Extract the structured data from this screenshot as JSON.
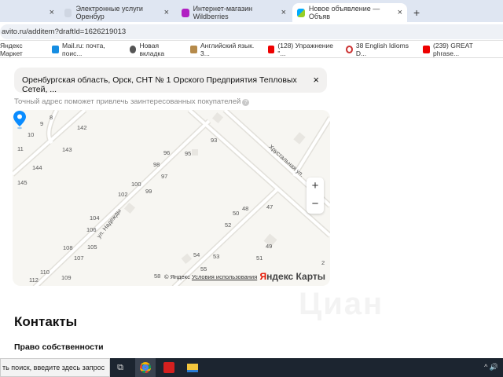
{
  "tabs": [
    {
      "label": "",
      "close": "×"
    },
    {
      "label": "Электронные услуги Оренбур",
      "close": "×"
    },
    {
      "label": "Интернет-магазин Wildberries",
      "close": "×"
    },
    {
      "label": "Новое объявление — Объяв",
      "close": "×",
      "active": true
    }
  ],
  "new_tab": "+",
  "url": "avito.ru/additem?draftId=1626219013",
  "bookmarks": [
    "Яндекс Маркет",
    "Mail.ru: почта, поис...",
    "Новая вкладка",
    "Английский язык. 3...",
    "(128) Упражнение \"...",
    "38 English Idioms D...",
    "(239) GREAT phrase..."
  ],
  "address": {
    "value": "Оренбургская область, Орск, СНТ № 1 Орского Предприятия Тепловых Сетей, ...",
    "clear": "×"
  },
  "hint": {
    "text": "Точный адрес поможет привлечь заинтересованных покупателей",
    "icon": "?"
  },
  "map": {
    "house_numbers": [
      "8",
      "9",
      "10",
      "11",
      "142",
      "143",
      "144",
      "145",
      "96",
      "95",
      "93",
      "98",
      "97",
      "100",
      "99",
      "102",
      "104",
      "106",
      "108",
      "105",
      "107",
      "110",
      "112",
      "109",
      "58",
      "54",
      "53",
      "55",
      "52",
      "50",
      "48",
      "47",
      "49",
      "51",
      "2"
    ],
    "streets": [
      "ул. Надежды",
      "Хрустальная ул."
    ],
    "zoom_in": "+",
    "zoom_out": "−",
    "copyright": "© Яндекс",
    "terms": "Условия использования",
    "logo_y": "Я",
    "logo_rest": "ндекс Карты",
    "pin_color": "#0a8cff"
  },
  "watermark": "Циан",
  "contacts_title": "Контакты",
  "ownership_label": "Право собственности",
  "taskbar": {
    "search": "ть поиск, введите здесь запрос",
    "tray": "^ 🔊"
  }
}
